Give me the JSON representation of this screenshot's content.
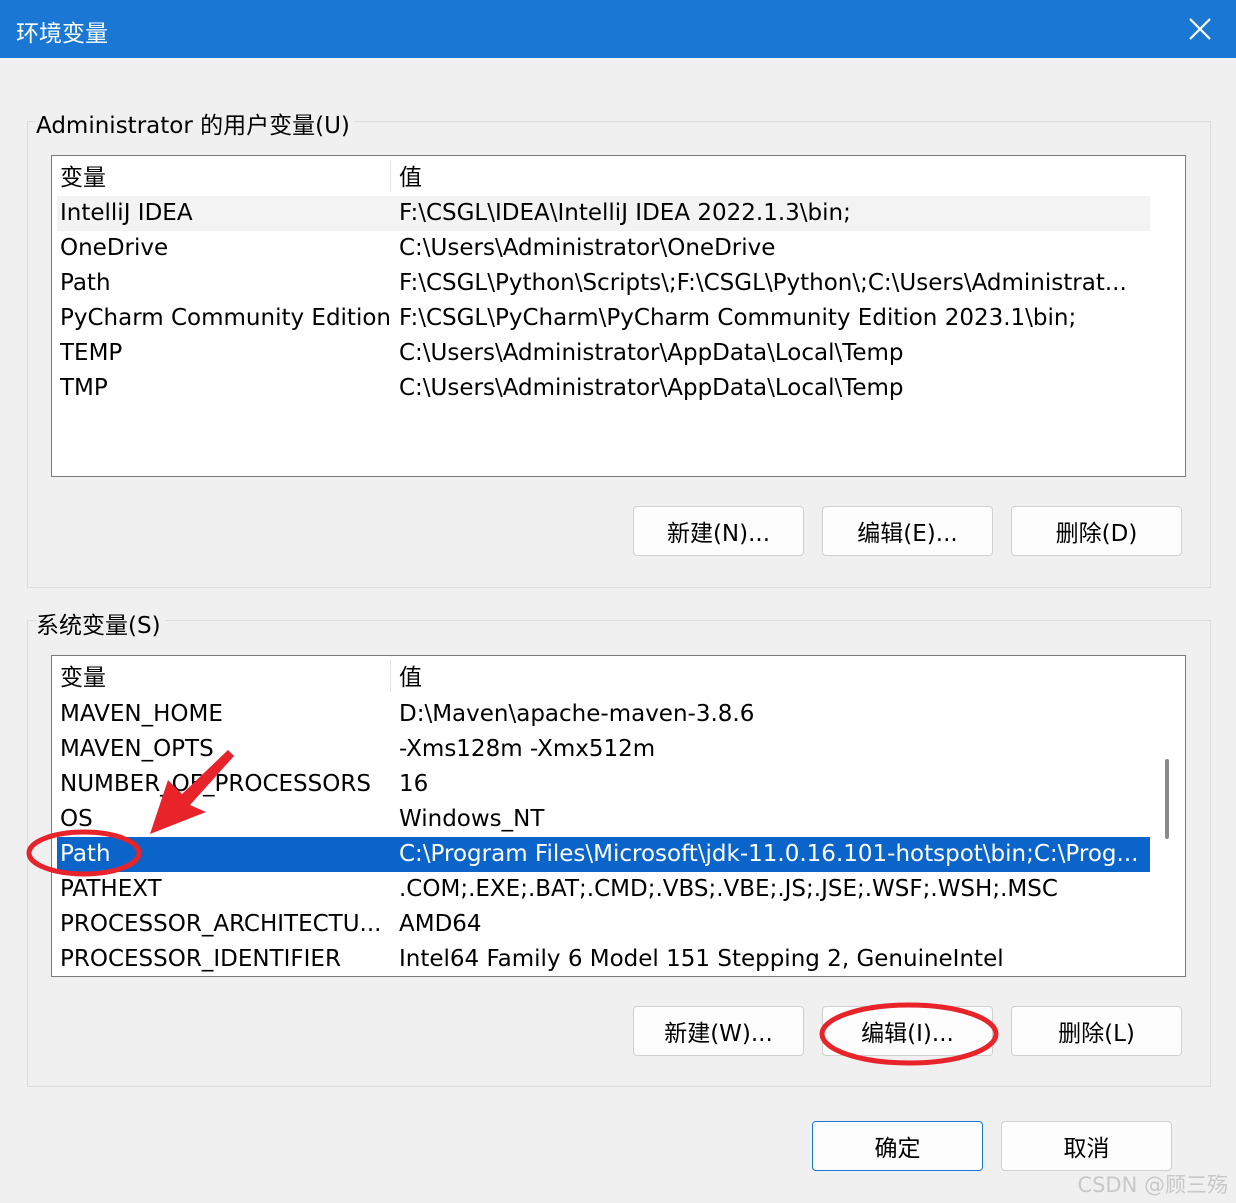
{
  "window": {
    "title": "环境变量"
  },
  "user_group": {
    "label": "Administrator 的用户变量(U)",
    "columns": [
      "变量",
      "值"
    ],
    "rows": [
      {
        "name": "IntelliJ IDEA",
        "value": "F:\\CSGL\\IDEA\\IntelliJ IDEA 2022.1.3\\bin;"
      },
      {
        "name": "OneDrive",
        "value": "C:\\Users\\Administrator\\OneDrive"
      },
      {
        "name": "Path",
        "value": "F:\\CSGL\\Python\\Scripts\\;F:\\CSGL\\Python\\;C:\\Users\\Administrat..."
      },
      {
        "name": "PyCharm Community Edition",
        "value": "F:\\CSGL\\PyCharm\\PyCharm Community Edition 2023.1\\bin;"
      },
      {
        "name": "TEMP",
        "value": "C:\\Users\\Administrator\\AppData\\Local\\Temp"
      },
      {
        "name": "TMP",
        "value": "C:\\Users\\Administrator\\AppData\\Local\\Temp"
      }
    ],
    "buttons": {
      "new": "新建(N)...",
      "edit": "编辑(E)...",
      "delete": "删除(D)"
    }
  },
  "system_group": {
    "label": "系统变量(S)",
    "columns": [
      "变量",
      "值"
    ],
    "rows": [
      {
        "name": "MAVEN_HOME",
        "value": "D:\\Maven\\apache-maven-3.8.6"
      },
      {
        "name": "MAVEN_OPTS",
        "value": "-Xms128m -Xmx512m"
      },
      {
        "name": "NUMBER_OF_PROCESSORS",
        "value": "16"
      },
      {
        "name": "OS",
        "value": "Windows_NT"
      },
      {
        "name": "Path",
        "value": "C:\\Program Files\\Microsoft\\jdk-11.0.16.101-hotspot\\bin;C:\\Prog..."
      },
      {
        "name": "PATHEXT",
        "value": ".COM;.EXE;.BAT;.CMD;.VBS;.VBE;.JS;.JSE;.WSF;.WSH;.MSC"
      },
      {
        "name": "PROCESSOR_ARCHITECTU...",
        "value": "AMD64"
      },
      {
        "name": "PROCESSOR_IDENTIFIER",
        "value": "Intel64 Family 6 Model 151 Stepping 2, GenuineIntel"
      }
    ],
    "buttons": {
      "new": "新建(W)...",
      "edit": "编辑(I)...",
      "delete": "删除(L)"
    }
  },
  "footer": {
    "ok": "确定",
    "cancel": "取消"
  },
  "watermark": "CSDN @顾三殇",
  "colors": {
    "titlebar": "#1a78d4",
    "selection": "#0a64c9",
    "annotation": "#e8232a"
  }
}
